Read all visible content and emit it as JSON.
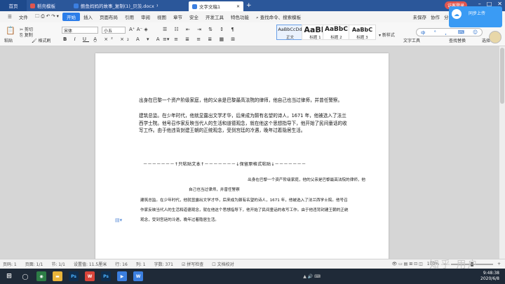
{
  "tabs": [
    {
      "label": "首页",
      "kind": "home"
    },
    {
      "label": "稻壳模板",
      "kind": "template",
      "color": "#e0564f"
    },
    {
      "label": "鲍鱼妈妈的故事_复制(1)_贝茨.docx",
      "kind": "doc",
      "color": "#3b7fe0"
    },
    {
      "label": "文字文稿1",
      "kind": "active",
      "color": "#3b7fe0"
    }
  ],
  "login_button": "访客登录",
  "cloud_badge": {
    "line1": "同步上传"
  },
  "menu": {
    "file": "文件",
    "items": [
      "开始",
      "插入",
      "页面布局",
      "引用",
      "审阅",
      "视图",
      "章节",
      "安全",
      "开发工具",
      "特色功能"
    ],
    "active_index": 0,
    "search": "查找命令、搜索模板",
    "right": [
      "未保存",
      "协作",
      "分享"
    ]
  },
  "ribbon": {
    "paste": "粘贴",
    "cut": "剪切",
    "copy": "复制",
    "format_painter": "格式刷",
    "font_name": "宋体",
    "font_size": "小五",
    "styles": [
      {
        "sample": "AaBbCcDd",
        "label": "正文"
      },
      {
        "sample": "AaBb",
        "label": "标题 1"
      },
      {
        "sample": "AaBbC",
        "label": "标题 2"
      },
      {
        "sample": "AaBbC",
        "label": "标题 3"
      }
    ],
    "text_tools": "文字工具",
    "find_replace": "查找替换",
    "select": "选择",
    "new_style": "新样式"
  },
  "ime": [
    "中",
    "°",
    "，",
    "⌨",
    "☺"
  ],
  "document": {
    "para1": "出身在巴黎一个资产阶级家庭，他的父亲是巴黎最高法院的律师，他自己也当过律师，并曾任警察。",
    "para2": "建筑总监。在少年时代，他就显露出文学才华，后来成为颇有名望的诗人，1671 年，他被选入了法兰西学士院。他号召作家反映当代人的生活和道德观念，就在他这个思想指导下，他开始了民间童话的收写工作。由于他违背封建王朝的正统观念，受到宫廷的冷遇，晚年过着隐居生活。",
    "separator": "－－－－－－－↑只粘贴文本↑－－－－－－－↓保留原格式粘贴↓－－－－－－－",
    "small1": "出身在巴黎一个资产阶级家庭，他的父亲是巴黎最高法院的律师，他",
    "small2": "自己也当过律师，并曾任警察",
    "small3": "建筑总监。在少年时代，他就显露出文学才华，后来成为颇有名望的诗人，1671 年，他被选入了法兰西学士院。他号召作家反映当代人的生活和道德观念，就在他这个思想指导下，他开始了民间童话的收写工作。由于他违背封建王朝的正统观念，受到宫廷的冷遇，晚年过着隐居生活。"
  },
  "status": {
    "page": "页码: 1",
    "pages": "页面: 1/1",
    "section": "节: 1/1",
    "setting": "设置值: 11.5厘米",
    "row": "行: 16",
    "col": "列: 1",
    "words": "字数: 371",
    "spell": "拼写检查",
    "doc_check": "文档校对",
    "zoom": "100%"
  },
  "watermark": "知乎 用户",
  "taskbar": {
    "time": "9:48:38",
    "date": "2020/6/8",
    "apps": [
      {
        "name": "start",
        "label": "",
        "color": "#1f2a38"
      },
      {
        "name": "search",
        "label": "",
        "color": "#1f2a38"
      },
      {
        "name": "browser",
        "label": "",
        "color": "#2d7d46"
      },
      {
        "name": "folder",
        "label": "",
        "color": "#e9b43a"
      },
      {
        "name": "photoshop",
        "label": "Ps",
        "color": "#0f2e4f"
      },
      {
        "name": "wps-writer",
        "label": "W",
        "color": "#d9443a"
      },
      {
        "name": "photoshop2",
        "label": "Ps",
        "color": "#0f2e4f"
      },
      {
        "name": "video",
        "label": "▶",
        "color": "#3b7fe0"
      },
      {
        "name": "wps",
        "label": "W",
        "color": "#3b7fe0"
      }
    ]
  }
}
